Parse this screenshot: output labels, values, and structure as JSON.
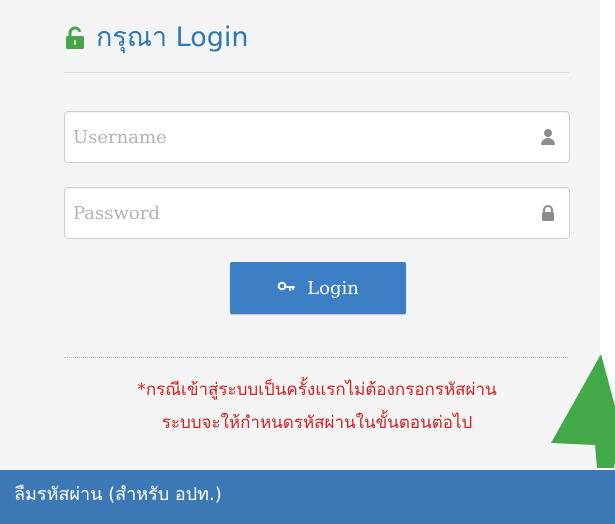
{
  "colors": {
    "panel_background": "#f4f4f4",
    "title": "#2f78b7",
    "lock_icon": "#47a647",
    "button_background": "#3c7fc4",
    "button_text": "#ffffff",
    "notice_text": "#d32222",
    "arrow": "#43a84a",
    "footer_background": "#3d78b6",
    "footer_text": "#ffffff",
    "field_border": "#cfcfcf",
    "field_icon": "#8c8c8c"
  },
  "icons": {
    "title": "unlock-icon",
    "username": "user-icon",
    "password": "lock-icon",
    "login_button": "key-icon",
    "decorative_arrow": "green-arrow"
  },
  "login": {
    "title": "กรุณา Login",
    "username_placeholder": "Username",
    "password_placeholder": "Password",
    "button_label": "Login"
  },
  "notice": {
    "line1": "*กรณีเข้าสู่ระบบเป็นครั้งแรกไม่ต้องกรอกรหัสผ่าน",
    "line2": "ระบบจะให้กำหนดรหัสผ่านในขั้นตอนต่อไป"
  },
  "footer": {
    "forgot_password_link": "ลืมรหัสผ่าน (สำหรับ อปท.)"
  }
}
